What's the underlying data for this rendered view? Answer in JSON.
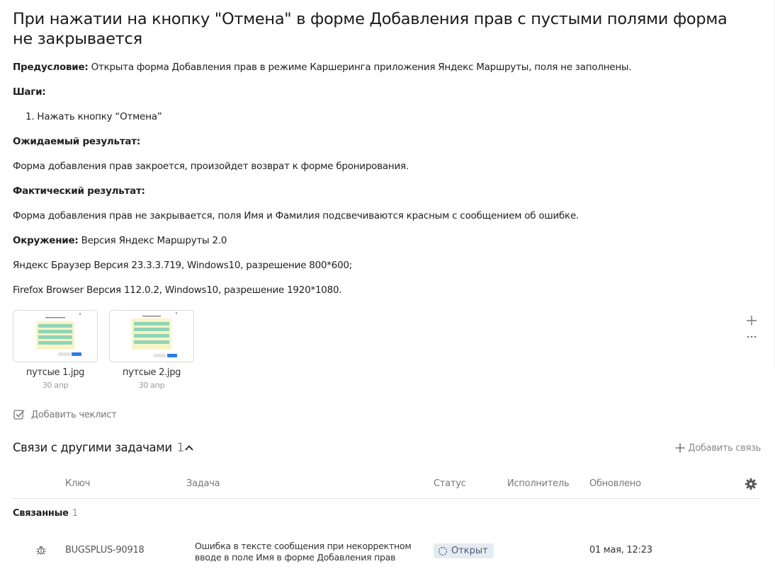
{
  "issue": {
    "title": "При нажатии на кнопку \"Отмена\" в форме Добавления прав с пустыми полями форма не закрывается",
    "precondition_label": "Предусловие:",
    "precondition_text": " Открыта форма Добавления прав в режиме Каршеринга приложения Яндекс Маршруты, поля не заполнены.",
    "steps_label": "Шаги:",
    "steps": [
      "1. Нажать кнопку “Отмена”"
    ],
    "expected_label": "Ожидаемый результат:",
    "expected_text": "Форма добавления прав закроется, произойдет возврат к форме бронирования.",
    "actual_label": "Фактический результат:",
    "actual_text": "Форма добавления прав не закрывается, поля Имя и Фамилия подсвечиваются красным с сообщением об ошибке.",
    "env_label": "Окружение:",
    "env_text": " Версия Яндекс Маршруты 2.0",
    "env_lines": [
      "Яндекс Браузер Версия 23.3.3.719, Windows10, разрешение 800*600;",
      "Firefox Browser Версия 112.0.2, Windows10, разрешение 1920*1080."
    ]
  },
  "attachments": [
    {
      "name": "путсые 1.jpg",
      "date": "30 апр"
    },
    {
      "name": "путсые 2.jpg",
      "date": "30 апр"
    }
  ],
  "checklist": {
    "label": "Добавить чеклист"
  },
  "links": {
    "title": "Связи с другими задачами",
    "count": "1",
    "add_label": "Добавить связь",
    "columns": {
      "key": "Ключ",
      "task": "Задача",
      "status": "Статус",
      "assignee": "Исполнитель",
      "updated": "Обновлено"
    },
    "group_label": "Связанные",
    "group_count": "1",
    "rows": [
      {
        "icon": "bug-icon",
        "key": "BUGSPLUS-90918",
        "task_line1": "Ошибка в тексте сообщения при некорректном",
        "task_line2": "вводе в поле Имя в форме Добавления прав",
        "status": "Открыт",
        "updated": "01 мая, 12:23"
      }
    ]
  },
  "colors": {
    "accent_status_bg": "#e6ebf1",
    "muted_text": "#777777"
  }
}
